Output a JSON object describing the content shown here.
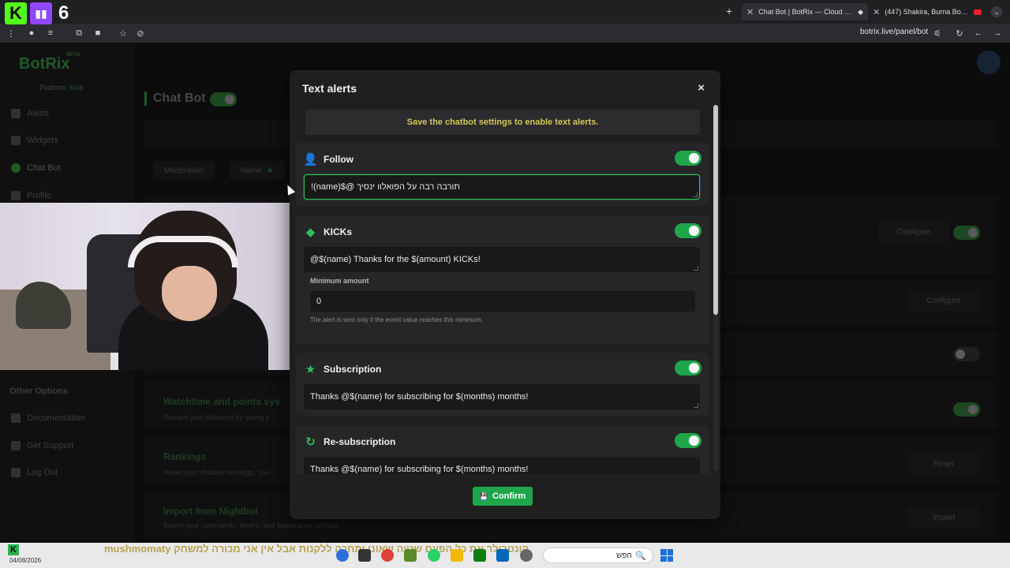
{
  "stream_overlay": {
    "kick_glyph": "K",
    "twitch_glyph": "▮▮",
    "twitch_count": "6"
  },
  "browser": {
    "tabs": [
      {
        "title": "Chat Bot | BotRix — Cloud Stre",
        "active": true
      },
      {
        "title": "(447) Shakira, Burna Boy - (",
        "active": false
      }
    ],
    "url": "botrix.live/panel/bot"
  },
  "dashboard": {
    "brand": "BotRix",
    "beta": "BETA",
    "platform_label": "Platform:",
    "platform_value": "Kick",
    "nav": [
      "Alerts",
      "Widgets",
      "Chat Bot",
      "Profile"
    ],
    "other_options_heading": "Other Options",
    "other_nav": [
      "Documentation",
      "Get Support",
      "Log Out"
    ],
    "page_title": "Chat Bot",
    "tabs": [
      "Moderation",
      "Name"
    ],
    "buttons": {
      "configure_1": "Configure",
      "configure_2": "Configure",
      "reset": "Reset",
      "import": "Import"
    },
    "sections": [
      {
        "title": "Watchtime and points sys",
        "desc": "Reward your followers by giving p"
      },
      {
        "title": "Rankings",
        "desc": "Reset your channel rankings. You"
      },
      {
        "title": "Import from Nightbot",
        "desc": "Import your commands, timers, and moderation settings"
      }
    ]
  },
  "modal": {
    "title": "Text alerts",
    "close_glyph": "×",
    "notice": "Save the chatbot settings to enable text alerts.",
    "alerts": [
      {
        "name": "Follow",
        "icon": "user-plus-icon",
        "glyph": "👤",
        "enabled": true,
        "message": "תורבה רבה על הפואלוו ינסיך @$(name)!"
      },
      {
        "name": "KICKs",
        "icon": "gem-icon",
        "glyph": "◆",
        "enabled": true,
        "message": "@$(name) Thanks for the $(amount) KICKs!"
      },
      {
        "name": "Subscription",
        "icon": "star-icon",
        "glyph": "★",
        "enabled": true,
        "message": "Thanks @$(name) for subscribing for $(months) months!"
      },
      {
        "name": "Re-subscription",
        "icon": "refresh-icon",
        "glyph": "↻",
        "enabled": true,
        "message": "Thanks @$(name) for subscribing for $(months) months!"
      }
    ],
    "minimum": {
      "label": "Minimum amount",
      "value": "0",
      "hint": "The alert is sent only if the event value reaches this minimum."
    },
    "confirm": "Confirm",
    "confirm_glyph": "💾"
  },
  "taskbar": {
    "ticker_user": "mushmomaty",
    "ticker_text": "קונטרולר את כל הפעם שנייה שאוני ותחכה ללקנות אבל אין אני מכורה למשחק",
    "date": "04/08/2026",
    "search_placeholder": "חפש",
    "search_glyph": "🔍"
  },
  "colors": {
    "accent": "#1fa64a",
    "notice_text": "#d4c75a",
    "modal_bg": "#1f1f20"
  }
}
